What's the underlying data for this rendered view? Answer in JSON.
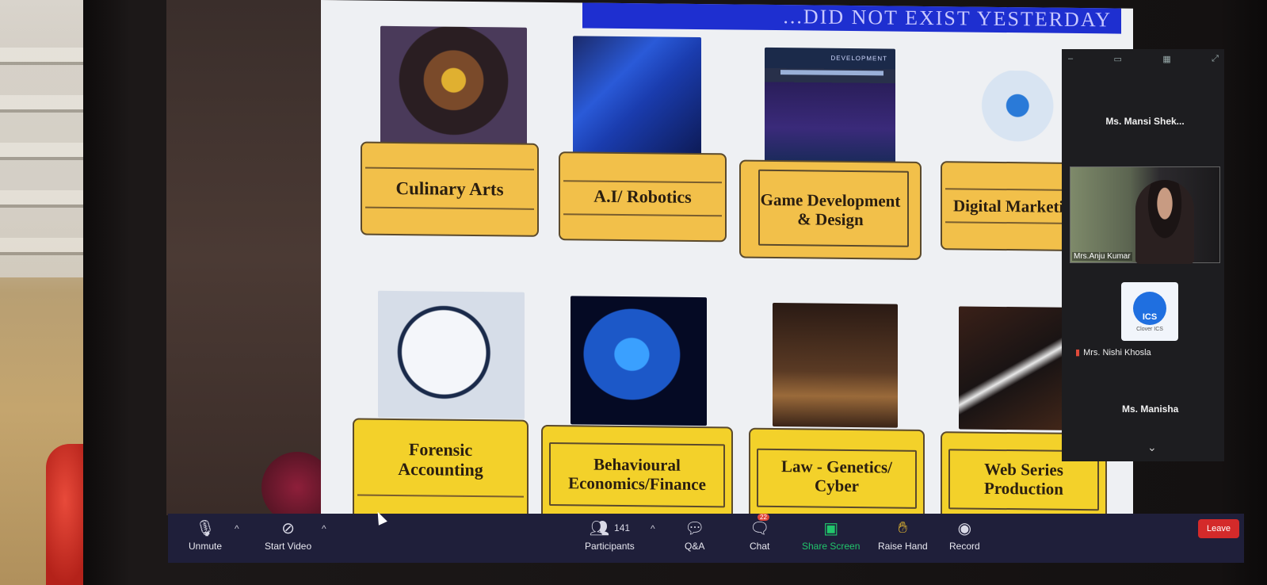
{
  "slide": {
    "banner_text": "...DID NOT EXIST YESTERDAY",
    "row1": [
      {
        "label": "Culinary Arts"
      },
      {
        "label": "A.I/ Robotics"
      },
      {
        "label": "Game Development & Design"
      },
      {
        "label": "Digital Marketi"
      }
    ],
    "row2": [
      {
        "label": "Forensic Accounting"
      },
      {
        "label": "Behavioural Economics/Finance"
      },
      {
        "label": "Law - Genetics/ Cyber"
      },
      {
        "label": "Web Series Production"
      }
    ],
    "image_captions": {
      "game_dev_header": "DEVELOPMENT"
    }
  },
  "gallery": {
    "participants": [
      {
        "name": "Ms. Mansi Shek..."
      },
      {
        "name": "Mrs.Anju Kumar"
      },
      {
        "name": "Mrs. Nishi Khosla",
        "logo_text": "ICS",
        "logo_sub": "Clover ICS"
      },
      {
        "name": "Ms. Manisha"
      }
    ]
  },
  "toolbar": {
    "unmute": "Unmute",
    "start_video": "Start Video",
    "participants_label": "Participants",
    "participants_count": "141",
    "qa": "Q&A",
    "chat": "Chat",
    "chat_badge": "22",
    "share_screen": "Share Screen",
    "raise_hand": "Raise Hand",
    "record": "Record",
    "leave": "Leave"
  },
  "colors": {
    "share_green": "#21c56b",
    "leave_red": "#d42a2a",
    "banner_blue": "#1e2fd0"
  }
}
